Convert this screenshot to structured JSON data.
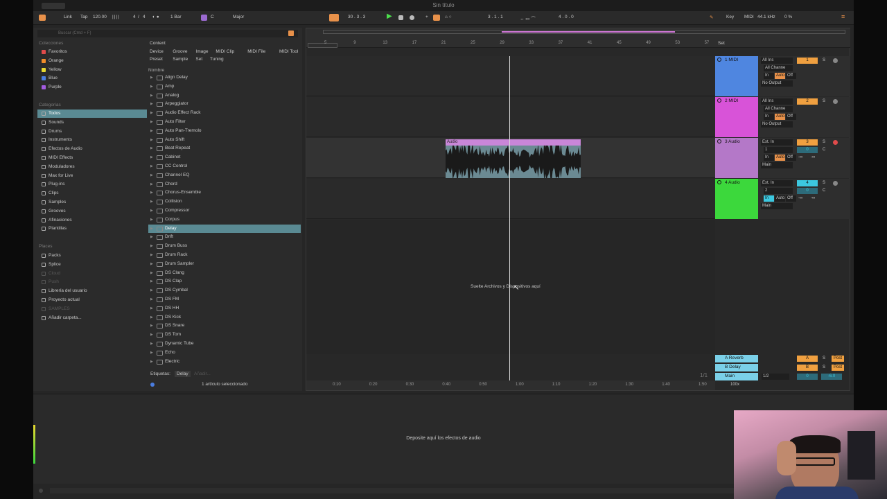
{
  "window": {
    "title": "Sin título"
  },
  "control_bar": {
    "link": "Link",
    "tap": "Tap",
    "tempo": "120.00",
    "time_sig_num": "4",
    "time_sig_sep": "/",
    "time_sig_den": "4",
    "quantize": "1 Bar",
    "key_root": "C",
    "scale": "Major",
    "position": "30 .  3 .  3",
    "loop_start": "3 .  1 .  1",
    "loop_length": "4 .  0 .  0",
    "key_label": "Key",
    "midi_label": "MIDI",
    "sample_rate": "44.1 kHz",
    "cpu": "0 %"
  },
  "browser": {
    "search_placeholder": "Buscar (Cmd + F)",
    "collections_header": "Colecciones",
    "collections": [
      {
        "label": "Favoritos",
        "color": "#e04b4b"
      },
      {
        "label": "Orange",
        "color": "#f08c2a"
      },
      {
        "label": "Yellow",
        "color": "#e8d930"
      },
      {
        "label": "Blue",
        "color": "#4a7de0"
      },
      {
        "label": "Purple",
        "color": "#a35be0"
      }
    ],
    "categories_header": "Categorías",
    "categories": [
      "Todos",
      "Sounds",
      "Drums",
      "Instruments",
      "Efectos de Audio",
      "MIDI Effects",
      "Moduladores",
      "Max for Live",
      "Plug-ins",
      "Clips",
      "Samples",
      "Grooves",
      "Afinaciones",
      "Plantillas"
    ],
    "places_header": "Places",
    "places": [
      "Packs",
      "Splice",
      "Cloud",
      "Push",
      "Librería del usuario",
      "Proyecto actual",
      "SAMPLES",
      "Añadir carpeta..."
    ],
    "content_label": "Content",
    "filter_row1": [
      "Device",
      "Groove",
      "Image",
      "MIDI Clip",
      "MIDI File",
      "MIDI Tool"
    ],
    "filter_row2": [
      "Preset",
      "Sample",
      "Set",
      "Tuning"
    ],
    "column_header": "Nombre",
    "items": [
      "Align Delay",
      "Amp",
      "Analog",
      "Arpeggiator",
      "Audio Effect Rack",
      "Auto Filter",
      "Auto Pan-Tremolo",
      "Auto Shift",
      "Beat Repeat",
      "Cabinet",
      "CC Control",
      "Channel EQ",
      "Chord",
      "Chorus-Ensemble",
      "Collision",
      "Compressor",
      "Corpus",
      "Delay",
      "Drift",
      "Drum Buss",
      "Drum Rack",
      "Drum Sampler",
      "DS Clang",
      "DS Clap",
      "DS Cymbal",
      "DS FM",
      "DS HH",
      "DS Kick",
      "DS Snare",
      "DS Tom",
      "Dynamic Tube",
      "Echo",
      "Electric"
    ],
    "selected_item": "Delay",
    "tags_label": "Etiquetas:",
    "tag_value": "Delay",
    "tag_add": "Añadir...",
    "selection_status": "1 artículo seleccionado"
  },
  "arrangement": {
    "bar_numbers": [
      "5",
      "9",
      "13",
      "17",
      "21",
      "25",
      "29",
      "33",
      "37",
      "41",
      "45",
      "49",
      "53",
      "57"
    ],
    "time_labels": [
      "0:10",
      "0:20",
      "0:30",
      "0:40",
      "0:50",
      "1:00",
      "1:10",
      "1:20",
      "1:30",
      "1:40",
      "1:50"
    ],
    "drop_hint": "Suelte Archivos y Dispositivos aquí",
    "clip_label": "Audio",
    "set_label": "Set",
    "page_indicator": "1/1",
    "tracks": [
      {
        "name": "1 MIDI",
        "color": "#4f86e0",
        "input": "All Ins",
        "channel": "All Channe",
        "monitor": [
          "In",
          "Auto",
          "Off"
        ],
        "output": "No Output",
        "number": "1",
        "num_color": "#f0a040"
      },
      {
        "name": "2 MIDI",
        "color": "#d853d8",
        "input": "All Ins",
        "channel": "All Channe",
        "monitor": [
          "In",
          "Auto",
          "Off"
        ],
        "output": "No Output",
        "number": "2",
        "num_color": "#f0a040"
      },
      {
        "name": "3 Audio",
        "color": "#b478c8",
        "input": "Ext. In",
        "channel": "1",
        "monitor": [
          "In",
          "Auto",
          "Off"
        ],
        "output": "Main",
        "number": "3",
        "num_color": "#f0a040"
      },
      {
        "name": "4 Audio",
        "color": "#3cd83c",
        "input": "Ext. In",
        "channel": "2",
        "monitor": [
          "In",
          "Auto",
          "Off"
        ],
        "output": "Main",
        "number": "4",
        "num_color": "#3cc8e0"
      }
    ],
    "returns": [
      {
        "name": "A Reverb",
        "color": "#7ad0e8",
        "letter": "A"
      },
      {
        "name": "B Delay",
        "color": "#7ad0e8",
        "letter": "B"
      }
    ],
    "main": {
      "name": "Main",
      "color": "#7ad0e8",
      "value": "1/2",
      "zero": "0",
      "db": "-6.0"
    },
    "zoom": "100x",
    "track_buttons": {
      "solo": "S",
      "post": "Post",
      "vol": "0",
      "pan": "C",
      "inf": "-∞"
    }
  },
  "detail": {
    "drop_hint": "Deposite aquí los efectos de audio"
  }
}
